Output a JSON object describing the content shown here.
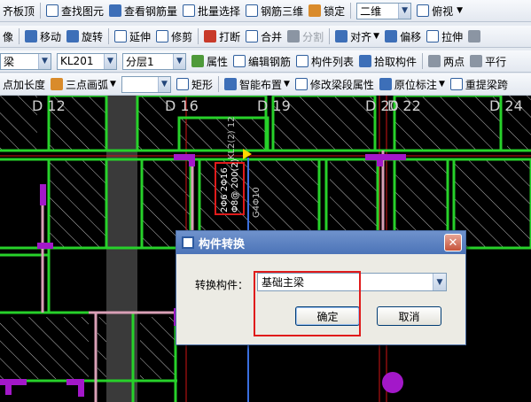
{
  "toolbar1": {
    "items": [
      "齐板顶",
      "查找图元",
      "查看钢筋量",
      "批量选择",
      "钢筋三维",
      "锁定"
    ],
    "view_mode": "二维",
    "view_dir": "俯视"
  },
  "toolbar2": {
    "items": [
      "像",
      "移动",
      "旋转",
      "延伸",
      "修剪",
      "打断",
      "合并",
      "分割",
      "对齐",
      "偏移",
      "拉伸"
    ]
  },
  "toolbar3": {
    "type_value": "梁",
    "component_value": "KL201",
    "floor_value": "分层1",
    "items": [
      "属性",
      "编辑钢筋",
      "构件列表",
      "拾取构件",
      "两点",
      "平行"
    ]
  },
  "toolbar4": {
    "items": [
      "点加长度",
      "三点画弧",
      "矩形",
      "智能布置",
      "修改梁段属性",
      "原位标注",
      "重提梁跨"
    ]
  },
  "canvas": {
    "axis_labels": [
      "D 12",
      "D 16",
      "D 19",
      "D 20",
      "D 22",
      "D 24"
    ],
    "beam_annotation_1": "KL2(2) 12",
    "beam_annotation_2": "2Φ6 2Φ16",
    "beam_annotation_3": "Φ8@ 200(2)",
    "beam_annotation_4": "G4Φ10"
  },
  "dialog": {
    "title": "构件转换",
    "label": "转换构件：",
    "selected": "基础主梁",
    "ok": "确定",
    "cancel": "取消"
  },
  "colors": {
    "wall_green": "#27d12a",
    "highlight_red": "#e01b1b",
    "column_magenta": "#a318c9",
    "grid_red": "#d01515"
  }
}
